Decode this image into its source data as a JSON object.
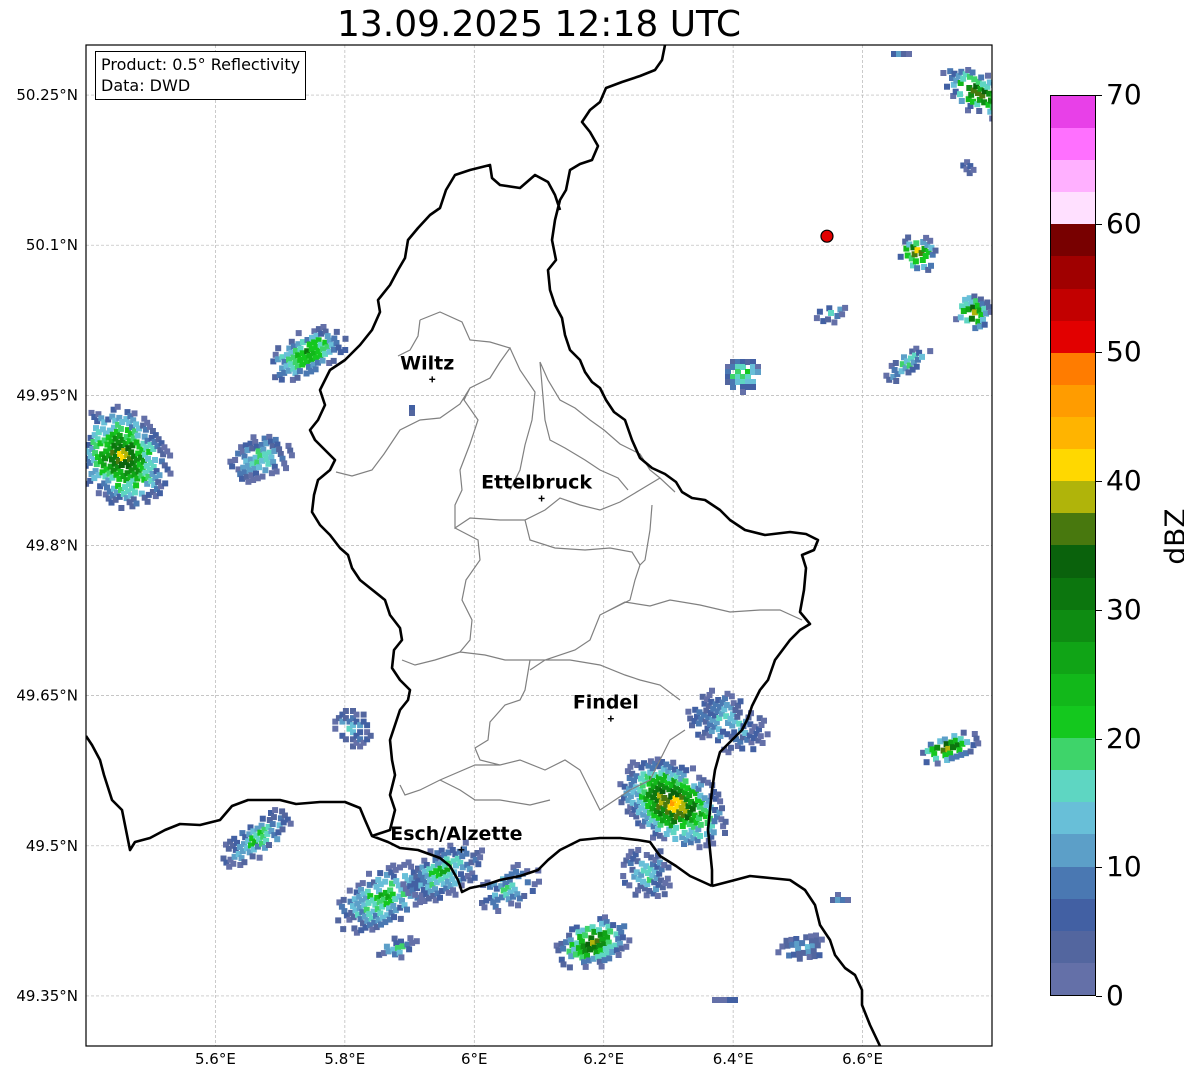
{
  "title": "13.09.2025 12:18 UTC",
  "info": {
    "product": "Product: 0.5° Reflectivity",
    "data": "Data: DWD"
  },
  "axes": {
    "lon_ticks": [
      {
        "value": 5.6,
        "label": "5.6°E"
      },
      {
        "value": 5.8,
        "label": "5.8°E"
      },
      {
        "value": 6.0,
        "label": "6°E"
      },
      {
        "value": 6.2,
        "label": "6.2°E"
      },
      {
        "value": 6.4,
        "label": "6.4°E"
      },
      {
        "value": 6.6,
        "label": "6.6°E"
      }
    ],
    "lat_ticks": [
      {
        "value": 50.25,
        "label": "50.25°N"
      },
      {
        "value": 50.1,
        "label": "50.1°N"
      },
      {
        "value": 49.95,
        "label": "49.95°N"
      },
      {
        "value": 49.8,
        "label": "49.8°N"
      },
      {
        "value": 49.65,
        "label": "49.65°N"
      },
      {
        "value": 49.5,
        "label": "49.5°N"
      },
      {
        "value": 49.35,
        "label": "49.35°N"
      }
    ],
    "lon_range": [
      5.4,
      6.8
    ],
    "lat_range": [
      49.3,
      50.3
    ],
    "grid": true
  },
  "cities": [
    {
      "name": "Wiltz",
      "lon": 5.935,
      "lat": 49.966
    },
    {
      "name": "Ettelbruck",
      "lon": 6.104,
      "lat": 49.847
    },
    {
      "name": "Findel",
      "lon": 6.211,
      "lat": 49.627
    },
    {
      "name": "Esch/Alzette",
      "lon": 5.98,
      "lat": 49.496
    }
  ],
  "marker": {
    "lon": 6.545,
    "lat": 50.109,
    "color": "#e00000"
  },
  "colorbar": {
    "label": "dBZ",
    "min": 0,
    "max": 70,
    "ticks": [
      {
        "value": 0,
        "label": "0"
      },
      {
        "value": 10,
        "label": "10"
      },
      {
        "value": 20,
        "label": "20"
      },
      {
        "value": 30,
        "label": "30"
      },
      {
        "value": 40,
        "label": "40"
      },
      {
        "value": 50,
        "label": "50"
      },
      {
        "value": 60,
        "label": "60"
      },
      {
        "value": 70,
        "label": "70"
      }
    ],
    "colors": [
      "#6470a8",
      "#53669f",
      "#4260a3",
      "#4a78b2",
      "#5c9fc8",
      "#68bfd8",
      "#5ed6c2",
      "#3ed46a",
      "#14c81e",
      "#12b81a",
      "#10a416",
      "#0e8c12",
      "#0c760e",
      "#0a620c",
      "#48780e",
      "#b0b40a",
      "#ffd800",
      "#ffb400",
      "#ff9c00",
      "#ff7c00",
      "#e20000",
      "#c20000",
      "#a00000",
      "#780000",
      "#ffe0ff",
      "#ffb0ff",
      "#ff70ff",
      "#e840e8"
    ]
  },
  "colors": {
    "border": "#000000",
    "cantons": "#808080",
    "grid": "#b4b4b4"
  }
}
